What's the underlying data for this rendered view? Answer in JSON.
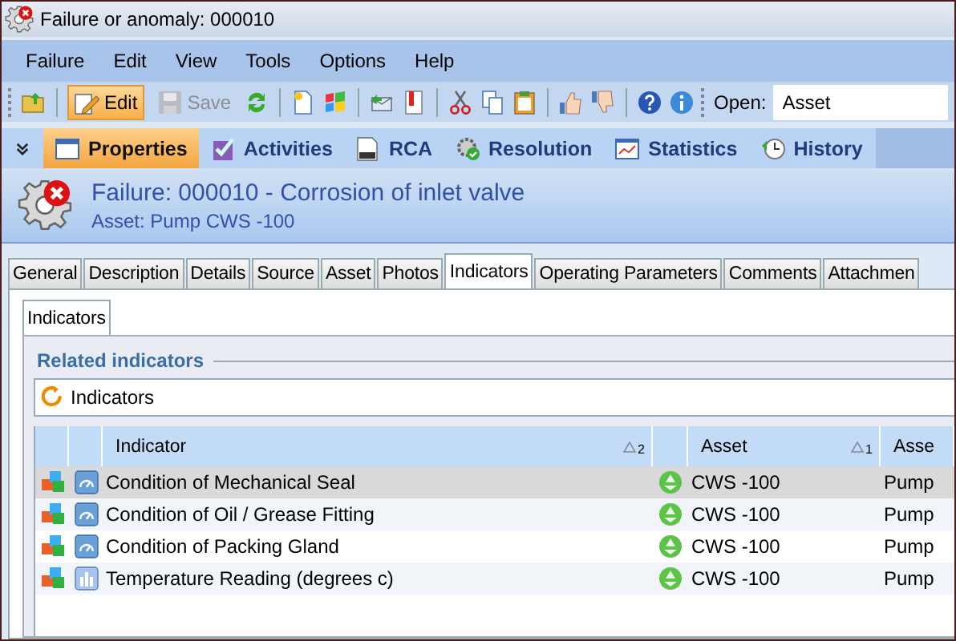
{
  "window": {
    "title": "Failure or anomaly: 000010"
  },
  "menu": [
    {
      "label": "Failure"
    },
    {
      "label": "Edit"
    },
    {
      "label": "View"
    },
    {
      "label": "Tools"
    },
    {
      "label": "Options"
    },
    {
      "label": "Help"
    }
  ],
  "toolbar": {
    "edit": {
      "label": "Edit",
      "active": true
    },
    "save": {
      "label": "Save",
      "disabled": true
    },
    "open_label": "Open:",
    "open_field": {
      "value": "Asset"
    }
  },
  "nav": [
    {
      "label": "Properties",
      "selected": true
    },
    {
      "label": "Activities",
      "selected": false
    },
    {
      "label": "RCA",
      "selected": false
    },
    {
      "label": "Resolution",
      "selected": false
    },
    {
      "label": "Statistics",
      "selected": false
    },
    {
      "label": "History",
      "selected": false
    }
  ],
  "header": {
    "title": "Failure: 000010 - Corrosion of inlet valve",
    "subtitle": "Asset: Pump CWS -100"
  },
  "tabs": [
    {
      "label": "General",
      "selected": false
    },
    {
      "label": "Description",
      "selected": false
    },
    {
      "label": "Details",
      "selected": false
    },
    {
      "label": "Source",
      "selected": false
    },
    {
      "label": "Asset",
      "selected": false
    },
    {
      "label": "Photos",
      "selected": false
    },
    {
      "label": "Indicators",
      "selected": true
    },
    {
      "label": "Operating Parameters",
      "selected": false
    },
    {
      "label": "Comments",
      "selected": false
    },
    {
      "label": "Attachmen",
      "selected": false
    }
  ],
  "subtabs": [
    {
      "label": "Indicators",
      "selected": true
    }
  ],
  "section": {
    "title": "Related indicators",
    "bar_label": "Indicators"
  },
  "table": {
    "columns": [
      {
        "label": "Indicator",
        "sort_index": "2"
      },
      {
        "label": "Asset",
        "sort_index": "1"
      },
      {
        "label": "Asse"
      }
    ],
    "rows": [
      {
        "kind": "gauge",
        "indicator": "Condition of Mechanical Seal",
        "asset": "CWS -100",
        "column_3": "Pump",
        "selected": true
      },
      {
        "kind": "gauge",
        "indicator": "Condition of Oil / Grease Fitting",
        "asset": "CWS -100",
        "column_3": "Pump",
        "selected": false
      },
      {
        "kind": "gauge",
        "indicator": "Condition of Packing Gland",
        "asset": "CWS -100",
        "column_3": "Pump",
        "selected": false
      },
      {
        "kind": "chart",
        "indicator": "Temperature Reading (degrees c)",
        "asset": "CWS -100",
        "column_3": "Pump",
        "selected": false
      }
    ]
  }
}
